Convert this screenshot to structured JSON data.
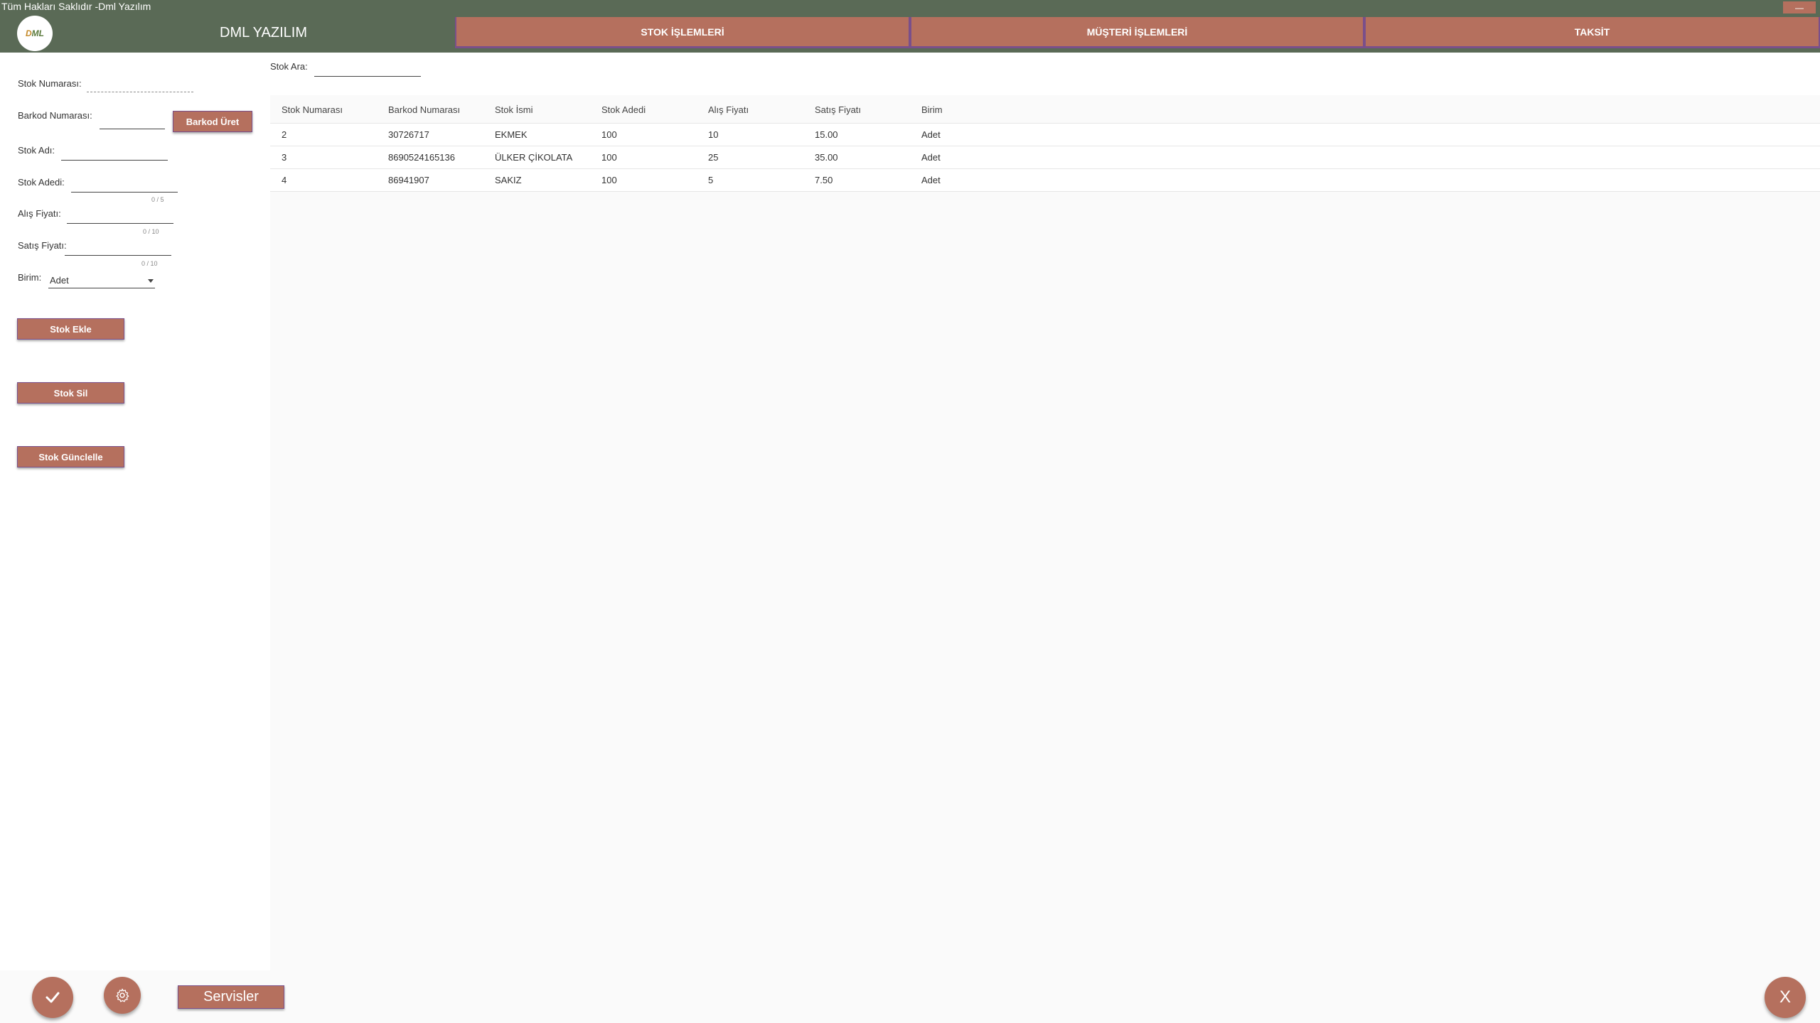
{
  "window": {
    "title": "Tüm Hakları Saklıdır -Dml Yazılım",
    "minimize_label": "—"
  },
  "header": {
    "logo_text_d": "D",
    "logo_text_ml": "ML",
    "brand": "DML YAZILIM",
    "tabs": [
      {
        "label": "STOK İŞLEMLERİ"
      },
      {
        "label": "MÜŞTERİ İŞLEMLERİ"
      },
      {
        "label": "TAKSİT"
      }
    ]
  },
  "form": {
    "stok_numarasi_label": "Stok Numarası:",
    "barkod_numarasi_label": "Barkod Numarası:",
    "barkod_uret_label": "Barkod Üret",
    "stok_adi_label": "Stok Adı:",
    "stok_adedi_label": "Stok Adedi:",
    "stok_adedi_counter": "0 / 5",
    "alis_fiyati_label": "Alış Fiyatı:",
    "alis_fiyati_counter": "0 / 10",
    "satis_fiyati_label": "Satış Fiyatı:",
    "satis_fiyati_counter": "0 / 10",
    "birim_label": "Birim:",
    "birim_value": "Adet",
    "stok_ekle_label": "Stok Ekle",
    "stok_sil_label": "Stok Sil",
    "stok_guncelle_label": "Stok Günclelle"
  },
  "search": {
    "label": "Stok Ara:",
    "value": ""
  },
  "table": {
    "columns": [
      "Stok Numarası",
      "Barkod Numarası",
      "Stok İsmi",
      "Stok Adedi",
      "Alış Fiyatı",
      "Satış Fiyatı",
      "Birim"
    ],
    "rows": [
      [
        "2",
        "30726717",
        "EKMEK",
        "100",
        "10",
        "15.00",
        "Adet"
      ],
      [
        "3",
        "8690524165136",
        "ÜLKER ÇİKOLATA",
        "100",
        "25",
        "35.00",
        "Adet"
      ],
      [
        "4",
        "86941907",
        "SAKIZ",
        "100",
        "5",
        "7.50",
        "Adet"
      ]
    ]
  },
  "bottom": {
    "confirm_icon": "check-icon",
    "settings_icon": "gear-icon",
    "servisler_label": "Servisler",
    "close_label": "X"
  },
  "colors": {
    "header": "#5a6a56",
    "accent": "#b5705e",
    "accent_border": "#7a4f8a"
  }
}
